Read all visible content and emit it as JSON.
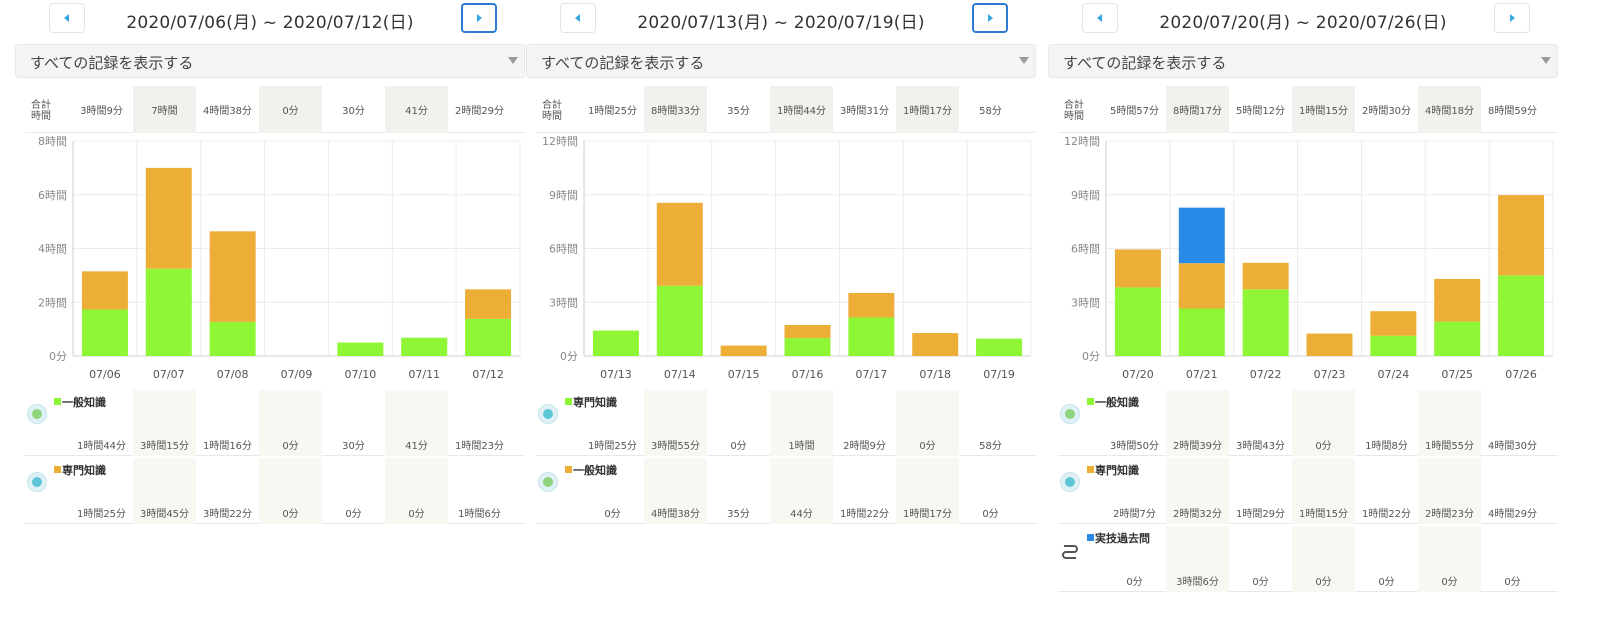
{
  "icons": {
    "prev": "triangle-left-icon",
    "next": "triangle-right-icon",
    "caret": "caret-down-icon"
  },
  "colors": {
    "green": "#8ef634",
    "orange": "#edae37",
    "blue": "#2a8ae8",
    "nav_active": "#2e7bd6"
  },
  "totals_label": "合計 時間",
  "panels": [
    {
      "range": "2020/07/06(月) ~ 2020/07/12(日)",
      "filter": "すべての記録を表示する",
      "next_active": true,
      "totals": [
        "3時間9分",
        "7時間",
        "4時間38分",
        "0分",
        "30分",
        "41分",
        "2時間29分"
      ],
      "categories": [
        {
          "name": "一般知識",
          "color": "green",
          "icon": "knowledge-icon",
          "values": [
            "1時間44分",
            "3時間15分",
            "1時間16分",
            "0分",
            "30分",
            "41分",
            "1時間23分"
          ]
        },
        {
          "name": "専門知識",
          "color": "orange",
          "icon": "specialty-icon",
          "values": [
            "1時間25分",
            "3時間45分",
            "3時間22分",
            "0分",
            "0分",
            "0分",
            "1時間6分"
          ]
        }
      ],
      "chart_data": {
        "type": "bar",
        "stacked": true,
        "categories": [
          "07/06",
          "07/07",
          "07/08",
          "07/09",
          "07/10",
          "07/11",
          "07/12"
        ],
        "y_ticks": [
          "0分",
          "2時間",
          "4時間",
          "6時間",
          "8時間"
        ],
        "ylim": [
          0,
          8
        ],
        "series": [
          {
            "name": "一般知識",
            "color": "green",
            "values": [
              1.73,
              3.25,
              1.27,
              0,
              0.5,
              0.68,
              1.38
            ]
          },
          {
            "name": "専門知識",
            "color": "orange",
            "values": [
              1.42,
              3.75,
              3.37,
              0,
              0,
              0,
              1.1
            ]
          }
        ]
      }
    },
    {
      "range": "2020/07/13(月) ~ 2020/07/19(日)",
      "filter": "すべての記録を表示する",
      "next_active": true,
      "totals": [
        "1時間25分",
        "8時間33分",
        "35分",
        "1時間44分",
        "3時間31分",
        "1時間17分",
        "58分"
      ],
      "categories": [
        {
          "name": "専門知識",
          "color": "green",
          "icon": "specialty-icon",
          "values": [
            "1時間25分",
            "3時間55分",
            "0分",
            "1時間",
            "2時間9分",
            "0分",
            "58分"
          ]
        },
        {
          "name": "一般知識",
          "color": "orange",
          "icon": "knowledge-icon",
          "values": [
            "0分",
            "4時間38分",
            "35分",
            "44分",
            "1時間22分",
            "1時間17分",
            "0分"
          ]
        }
      ],
      "chart_data": {
        "type": "bar",
        "stacked": true,
        "categories": [
          "07/13",
          "07/14",
          "07/15",
          "07/16",
          "07/17",
          "07/18",
          "07/19"
        ],
        "y_ticks": [
          "0分",
          "3時間",
          "6時間",
          "9時間",
          "12時間"
        ],
        "ylim": [
          0,
          12
        ],
        "series": [
          {
            "name": "専門知識",
            "color": "green",
            "values": [
              1.42,
              3.92,
              0,
              1.0,
              2.15,
              0,
              0.97
            ]
          },
          {
            "name": "一般知識",
            "color": "orange",
            "values": [
              0,
              4.63,
              0.58,
              0.73,
              1.37,
              1.28,
              0
            ]
          }
        ]
      }
    },
    {
      "range": "2020/07/20(月) ~ 2020/07/26(日)",
      "filter": "すべての記録を表示する",
      "next_active": false,
      "totals": [
        "5時間57分",
        "8時間17分",
        "5時間12分",
        "1時間15分",
        "2時間30分",
        "4時間18分",
        "8時間59分"
      ],
      "categories": [
        {
          "name": "一般知識",
          "color": "green",
          "icon": "knowledge-icon",
          "values": [
            "3時間50分",
            "2時間39分",
            "3時間43分",
            "0分",
            "1時間8分",
            "1時間55分",
            "4時間30分"
          ]
        },
        {
          "name": "専門知識",
          "color": "orange",
          "icon": "specialty-icon",
          "values": [
            "2時間7分",
            "2時間32分",
            "1時間29分",
            "1時間15分",
            "1時間22分",
            "2時間23分",
            "4時間29分"
          ]
        },
        {
          "name": "実技過去問",
          "color": "blue",
          "icon": "practice-icon",
          "values": [
            "0分",
            "3時間6分",
            "0分",
            "0分",
            "0分",
            "0分",
            "0分"
          ]
        }
      ],
      "chart_data": {
        "type": "bar",
        "stacked": true,
        "categories": [
          "07/20",
          "07/21",
          "07/22",
          "07/23",
          "07/24",
          "07/25",
          "07/26"
        ],
        "y_ticks": [
          "0分",
          "3時間",
          "6時間",
          "9時間",
          "12時間"
        ],
        "ylim": [
          0,
          12
        ],
        "series": [
          {
            "name": "一般知識",
            "color": "green",
            "values": [
              3.83,
              2.65,
              3.72,
              0,
              1.13,
              1.92,
              4.5
            ]
          },
          {
            "name": "専門知識",
            "color": "orange",
            "values": [
              2.12,
              2.53,
              1.48,
              1.25,
              1.37,
              2.38,
              4.48
            ]
          },
          {
            "name": "実技過去問",
            "color": "blue",
            "values": [
              0,
              3.1,
              0,
              0,
              0,
              0,
              0
            ]
          }
        ]
      }
    }
  ]
}
